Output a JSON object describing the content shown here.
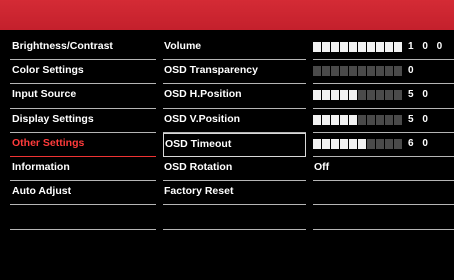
{
  "colors": {
    "title_bar": "#c4202c",
    "selected_text": "#ff3b3b",
    "bar_filled": "#f2f2f2",
    "bar_empty": "#4a4a4a"
  },
  "menu": {
    "items": [
      {
        "label": "Brightness/Contrast"
      },
      {
        "label": "Color Settings"
      },
      {
        "label": "Input Source"
      },
      {
        "label": "Display Settings"
      },
      {
        "label": "Other Settings",
        "selected": true
      },
      {
        "label": "Information"
      },
      {
        "label": "Auto Adjust"
      },
      {
        "label": ""
      }
    ]
  },
  "settings": {
    "items": [
      {
        "label": "Volume"
      },
      {
        "label": "OSD Transparency"
      },
      {
        "label": "OSD H.Position"
      },
      {
        "label": "OSD V.Position"
      },
      {
        "label": "OSD Timeout"
      },
      {
        "label": "OSD Rotation"
      },
      {
        "label": "Factory Reset"
      },
      {
        "label": ""
      }
    ]
  },
  "values": {
    "items": [
      {
        "type": "bar",
        "level": 1.0,
        "text": "1 0 0"
      },
      {
        "type": "bar",
        "level": 0.0,
        "text": "0"
      },
      {
        "type": "bar",
        "level": 0.5,
        "text": "5 0"
      },
      {
        "type": "bar",
        "level": 0.5,
        "text": "5 0"
      },
      {
        "type": "bar",
        "level": 0.6,
        "text": "6 0"
      },
      {
        "type": "text",
        "text": "Off"
      },
      {
        "type": "text",
        "text": ""
      },
      {
        "type": "text",
        "text": ""
      }
    ]
  }
}
